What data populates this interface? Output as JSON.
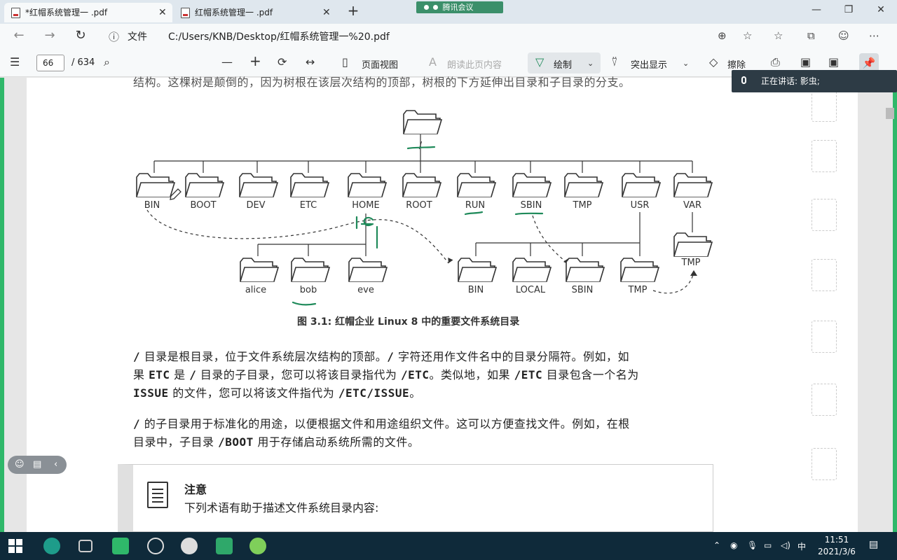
{
  "window": {
    "tabs": [
      {
        "label": "*红帽系统管理一 .pdf",
        "active": true
      },
      {
        "label": "红帽系统管理一 .pdf",
        "active": false
      }
    ],
    "meeting_badge": "腾讯会议"
  },
  "address_bar": {
    "file_label": "文件",
    "url": "C:/Users/KNB/Desktop/红帽系统管理一%20.pdf"
  },
  "pdf_toolbar": {
    "current_page": "66",
    "total_pages": "/ 634",
    "page_view": "页面视图",
    "read_aloud": "朗读此页内容",
    "draw": "绘制",
    "highlight": "突出显示",
    "erase": "擦除"
  },
  "speaker": {
    "text": "正在讲话: 影虫;"
  },
  "document": {
    "top_line": "结构。这棵树是颠倒的，因为树根在该层次结构的顶部，树根的下方延伸出目录和子目录的分支。",
    "diagram": {
      "root": "/",
      "top_dirs": [
        "BIN",
        "BOOT",
        "DEV",
        "ETC",
        "HOME",
        "ROOT",
        "RUN",
        "SBIN",
        "TMP",
        "USR",
        "VAR"
      ],
      "home_dirs": [
        "alice",
        "bob",
        "eve"
      ],
      "usr_dirs": [
        "BIN",
        "LOCAL",
        "SBIN",
        "TMP"
      ],
      "var_dirs": [
        "TMP"
      ]
    },
    "caption": "图 3.1: 红帽企业 Linux 8 中的重要文件系统目录",
    "para1": {
      "l1_a": "/",
      "l1_b": " 目录是根目录，位于文件系统层次结构的顶部。",
      "l1_c": "/",
      "l1_d": " 字符还用作文件名中的目录分隔符。例如，如",
      "l2_a": "果 ",
      "l2_b": "etc",
      "l2_c": " 是 ",
      "l2_d": "/",
      "l2_e": " 目录的子目录，您可以将该目录指代为 ",
      "l2_f": "/etc",
      "l2_g": "。类似地，如果 ",
      "l2_h": "/etc",
      "l2_i": " 目录包含一个名为",
      "l3_a": "issue",
      "l3_b": " 的文件，您可以将该文件指代为 ",
      "l3_c": "/etc/issue",
      "l3_d": "。"
    },
    "para2": {
      "l1_a": "/",
      "l1_b": " 的子目录用于标准化的用途，以便根据文件和用途组织文件。这可以方便查找文件。例如，在根",
      "l2_a": "目录中，子目录 ",
      "l2_b": "/boot",
      "l2_c": " 用于存储启动系统所需的文件。"
    },
    "note": {
      "title": "注意",
      "text": "下列术语有助于描述文件系统目录内容:"
    }
  },
  "taskbar": {
    "time": "11:51",
    "date": "2021/3/6",
    "ime": "中"
  },
  "colors": {
    "annotation": "#1f8a5a",
    "accent_green": "#2fb86a",
    "taskbar": "#0f2a3a"
  }
}
